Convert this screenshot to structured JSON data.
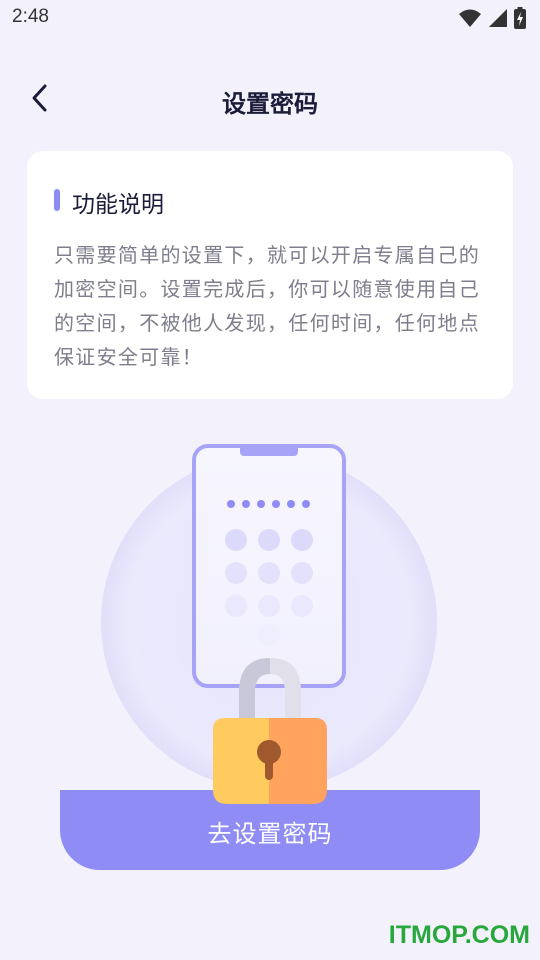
{
  "status_bar": {
    "time": "2:48",
    "icons": [
      "wifi-icon",
      "signal-icon",
      "battery-charging-icon"
    ]
  },
  "header": {
    "back_icon": "chevron-left-icon",
    "title": "设置密码"
  },
  "info_card": {
    "heading": "功能说明",
    "body": "只需要简单的设置下，就可以开启专属自己的加密空间。设置完成后，你可以随意使用自己的空间，不被他人发现，任何时间，任何地点保证安全可靠！"
  },
  "illustration": {
    "icon": "phone-lock-illustration",
    "password_dots": 6,
    "keypad_rows": 3
  },
  "primary_action": {
    "label": "去设置密码"
  },
  "watermark": "ITMOP.COM",
  "colors": {
    "background": "#f3f2fc",
    "accent": "#8f8cf6",
    "lock_left": "#ffcb5f",
    "lock_right": "#ffa35f",
    "watermark": "#28a83c"
  }
}
